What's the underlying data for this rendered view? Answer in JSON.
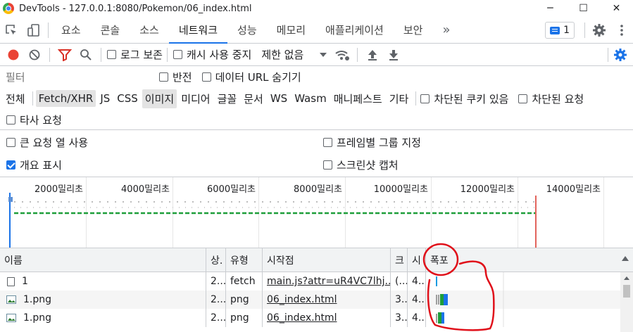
{
  "window": {
    "title": "DevTools - 127.0.0.1:8080/Pokemon/06_index.html",
    "minimize": "─",
    "maximize": "☐",
    "close": "✕"
  },
  "tabs": [
    {
      "label": "요소"
    },
    {
      "label": "콘솔"
    },
    {
      "label": "소스"
    },
    {
      "label": "네트워크",
      "active": true
    },
    {
      "label": "성능"
    },
    {
      "label": "메모리"
    },
    {
      "label": "애플리케이션"
    },
    {
      "label": "보안"
    }
  ],
  "more_tabs": "»",
  "messages_count": "1",
  "toolbar": {
    "preserve_log": "로그 보존",
    "disable_cache": "캐시 사용 중지",
    "throttling": "제한 없음"
  },
  "filter": {
    "placeholder": "필터",
    "invert": "반전",
    "hide_data_urls": "데이터 URL 숨기기"
  },
  "types": [
    "전체",
    "Fetch/XHR",
    "JS",
    "CSS",
    "이미지",
    "미디어",
    "글꼴",
    "문서",
    "WS",
    "Wasm",
    "매니페스트",
    "기타"
  ],
  "blocked_cookies": "차단된 쿠키 있음",
  "blocked_requests": "차단된 요청",
  "third_party": "타사 요청",
  "options": {
    "big_rows": "큰 요청 열 사용",
    "group_by_frame": "프레임별 그룹 지정",
    "overview": "개요 표시",
    "screenshots": "스크린샷 캡처"
  },
  "timeline_ticks": [
    "2000밀리초",
    "4000밀리초",
    "6000밀리초",
    "8000밀리초",
    "10000밀리초",
    "12000밀리초",
    "14000밀리초"
  ],
  "columns": {
    "name": "이름",
    "status": "상.",
    "type": "유형",
    "initiator": "시작점",
    "size": "크",
    "time": "시",
    "waterfall": "폭포"
  },
  "rows": [
    {
      "name": "1",
      "status": "2...",
      "type": "fetch",
      "initiator": "main.js?attr=uR4VC7lhj...",
      "size": "(...",
      "time": "4..."
    },
    {
      "name": "1.png",
      "status": "2...",
      "type": "png",
      "initiator": "06_index.html",
      "size": "3...",
      "time": "4..."
    },
    {
      "name": "1.png",
      "status": "2...",
      "type": "png",
      "initiator": "06_index.html",
      "size": "3...",
      "time": "4..."
    }
  ],
  "colors": {
    "accent": "#1a73e8",
    "record": "#ea4335",
    "annotation": "#e0101a",
    "overview_green": "#1e9e3a"
  }
}
